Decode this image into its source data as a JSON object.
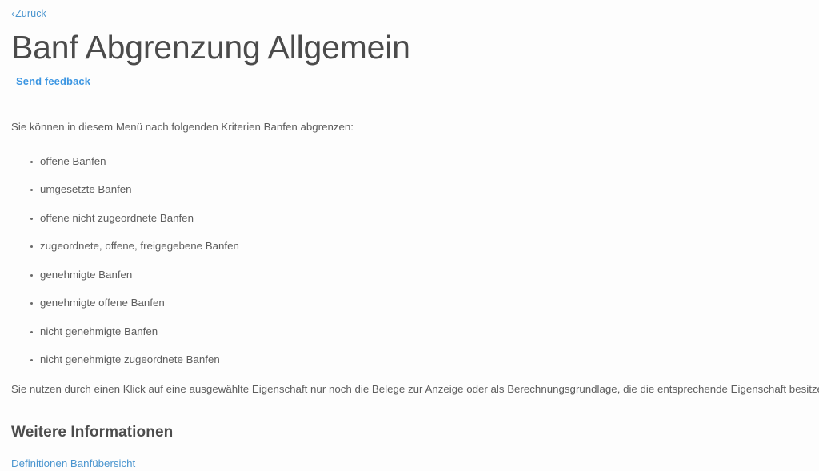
{
  "nav": {
    "back_label": "Zurück",
    "back_chevron": "chevron-left-icon"
  },
  "header": {
    "title": "Banf Abgrenzung Allgemein",
    "feedback_label": "Send feedback"
  },
  "main": {
    "intro": "Sie können in diesem Menü nach folgenden Kriterien Banfen abgrenzen:",
    "criteria": [
      "offene Banfen",
      "umgesetzte Banfen",
      "offene nicht zugeordnete Banfen",
      "zugeordnete, offene, freigegebene Banfen",
      "genehmigte Banfen",
      "genehmigte offene Banfen",
      "nicht genehmigte Banfen",
      "nicht genehmigte zugeordnete Banfen"
    ],
    "closing": "Sie nutzen durch einen Klick auf eine ausgewählte Eigenschaft nur noch die Belege zur Anzeige oder als Berechnungsgrundlage, die die entsprechende Eigenschaft besitzen."
  },
  "further_info": {
    "heading": "Weitere Informationen",
    "links": [
      "Definitionen Banfübersicht"
    ]
  },
  "colors": {
    "background": "#fdfdfd",
    "body_text": "#5d5d5d",
    "title_text": "#4b4b4b",
    "link_blue": "#4a95cf",
    "feedback_blue": "#3c96e2",
    "heading_text": "#4c4c4c"
  }
}
